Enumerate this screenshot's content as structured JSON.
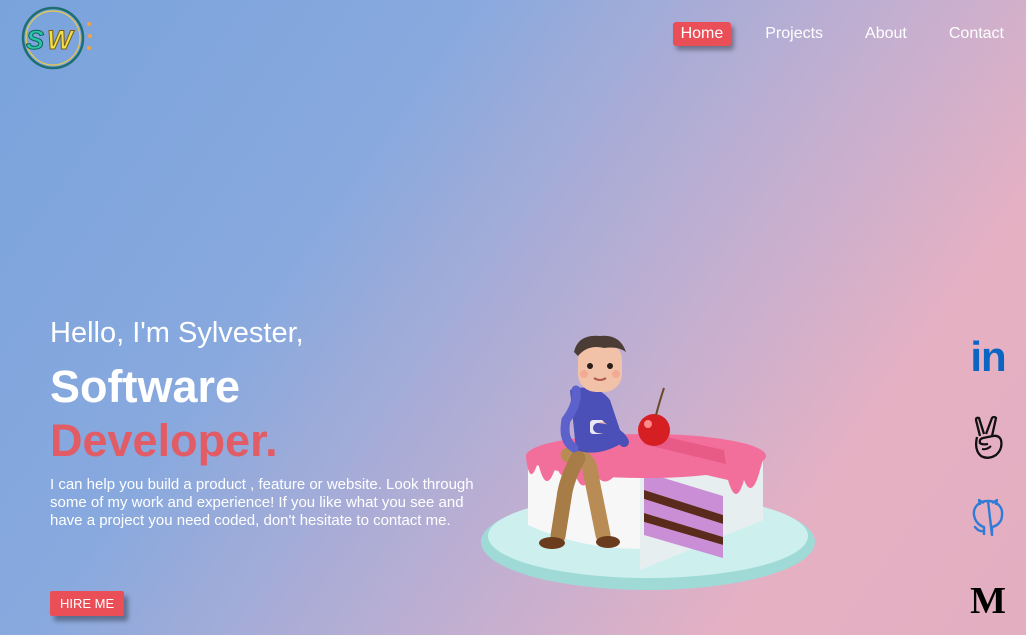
{
  "logo": {
    "text": "SW"
  },
  "nav": {
    "items": [
      {
        "label": "Home",
        "active": true
      },
      {
        "label": "Projects",
        "active": false
      },
      {
        "label": "About",
        "active": false
      },
      {
        "label": "Contact",
        "active": false
      }
    ]
  },
  "hero": {
    "greeting": "Hello, I'm Sylvester,",
    "role_line1": "Software",
    "role_line2": "Developer.",
    "description": "I can help you build a product , feature or website. Look through some of my work and experience! If you like what you see and have a project you need coded, don't hesitate to contact me.",
    "cta_label": "HIRE ME"
  },
  "social": {
    "linkedin_text": "in",
    "medium_text": "M"
  },
  "colors": {
    "accent": "#ea4f57",
    "role_highlight": "#e25c66",
    "linkedin": "#0a66c2",
    "github": "#2f7bd6"
  },
  "icons": [
    "logo-icon",
    "linkedin-icon",
    "angellist-icon",
    "github-icon",
    "medium-icon"
  ]
}
